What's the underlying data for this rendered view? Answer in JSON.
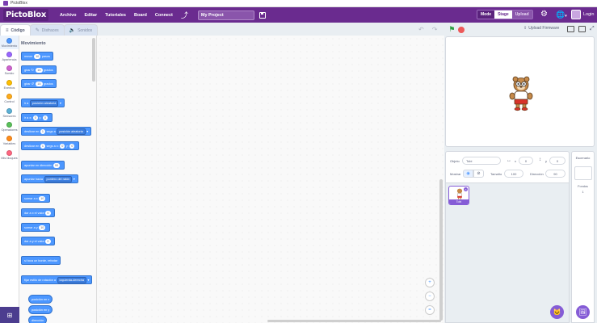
{
  "window": {
    "title": "PictoBlox"
  },
  "menubar": {
    "logo": "PictoBlox",
    "items": [
      "Archivo",
      "Editar",
      "Tutoriales",
      "Board",
      "Connect"
    ],
    "project_name": "My Project",
    "mode_label": "Mode",
    "stage_label": "Stage",
    "upload_label": "Upload",
    "login_label": "Login",
    "accent": "#6a2b8f"
  },
  "tabs": {
    "code": "Código",
    "costumes": "Disfraces",
    "sounds": "Sonidos"
  },
  "toolbar": {
    "upload_firmware": "Upload Firmware"
  },
  "categories": [
    {
      "label": "Movimiento",
      "color": "#4c97ff"
    },
    {
      "label": "Apariencia",
      "color": "#9966ff"
    },
    {
      "label": "Sonido",
      "color": "#cf63cf"
    },
    {
      "label": "Eventos",
      "color": "#ffbf00"
    },
    {
      "label": "Control",
      "color": "#ffab19"
    },
    {
      "label": "Sensores",
      "color": "#5cb1d6"
    },
    {
      "label": "Operadores",
      "color": "#59c059"
    },
    {
      "label": "Variables",
      "color": "#ff8c1a"
    },
    {
      "label": "Mis bloques",
      "color": "#ff6680"
    }
  ],
  "palette": {
    "title": "Movimiento",
    "blocks": {
      "move": {
        "pre": "mover",
        "val": "10",
        "post": "pasos"
      },
      "turn_right": {
        "pre": "girar",
        "icon": "↻",
        "val": "15",
        "post": "grados"
      },
      "turn_left": {
        "pre": "girar",
        "icon": "↺",
        "val": "15",
        "post": "grados"
      },
      "goto": {
        "pre": "ir a",
        "drop": "posición aleatoria"
      },
      "goto_xy": {
        "pre": "ir a x:",
        "x": "0",
        "mid": "y:",
        "y": "0"
      },
      "glide_to": {
        "pre": "deslizar en",
        "val": "1",
        "mid": "segs a",
        "drop": "posición aleatoria"
      },
      "glide_xy": {
        "pre": "deslizar en",
        "val": "1",
        "mid": "segs a x:",
        "x": "0",
        "mid2": "y:",
        "y": "0"
      },
      "point_dir": {
        "pre": "apuntar en dirección",
        "val": "90"
      },
      "point_towards": {
        "pre": "apuntar hacia",
        "drop": "puntero del ratón"
      },
      "change_x": {
        "pre": "sumar a x",
        "val": "10"
      },
      "set_x": {
        "pre": "dar a x el valor",
        "val": "0"
      },
      "change_y": {
        "pre": "sumar a y",
        "val": "10"
      },
      "set_y": {
        "pre": "dar a y el valor",
        "val": "0"
      },
      "bounce": {
        "text": "si toca un borde, rebotar"
      },
      "rotation_style": {
        "pre": "fijar estilo de rotación a",
        "drop": "izquierda-derecha"
      },
      "rep_x": "posición en x",
      "rep_y": "posición en y",
      "rep_dir": "dirección"
    }
  },
  "workspace": {
    "zoom_in": "+",
    "zoom_out": "−",
    "reset": "="
  },
  "sprite_info": {
    "sprite_label": "Objeto",
    "sprite_name": "Tobi",
    "x_label": "x",
    "x_val": "0",
    "y_label": "y",
    "y_val": "0",
    "show_label": "Mostrar",
    "size_label": "Tamaño",
    "size_val": "100",
    "dir_label": "Dirección",
    "dir_val": "90"
  },
  "sprites": [
    {
      "name": "Tobi"
    }
  ],
  "stage_pane": {
    "title": "Escenario",
    "backdrops_label": "Fondos",
    "backdrops_count": "1"
  }
}
